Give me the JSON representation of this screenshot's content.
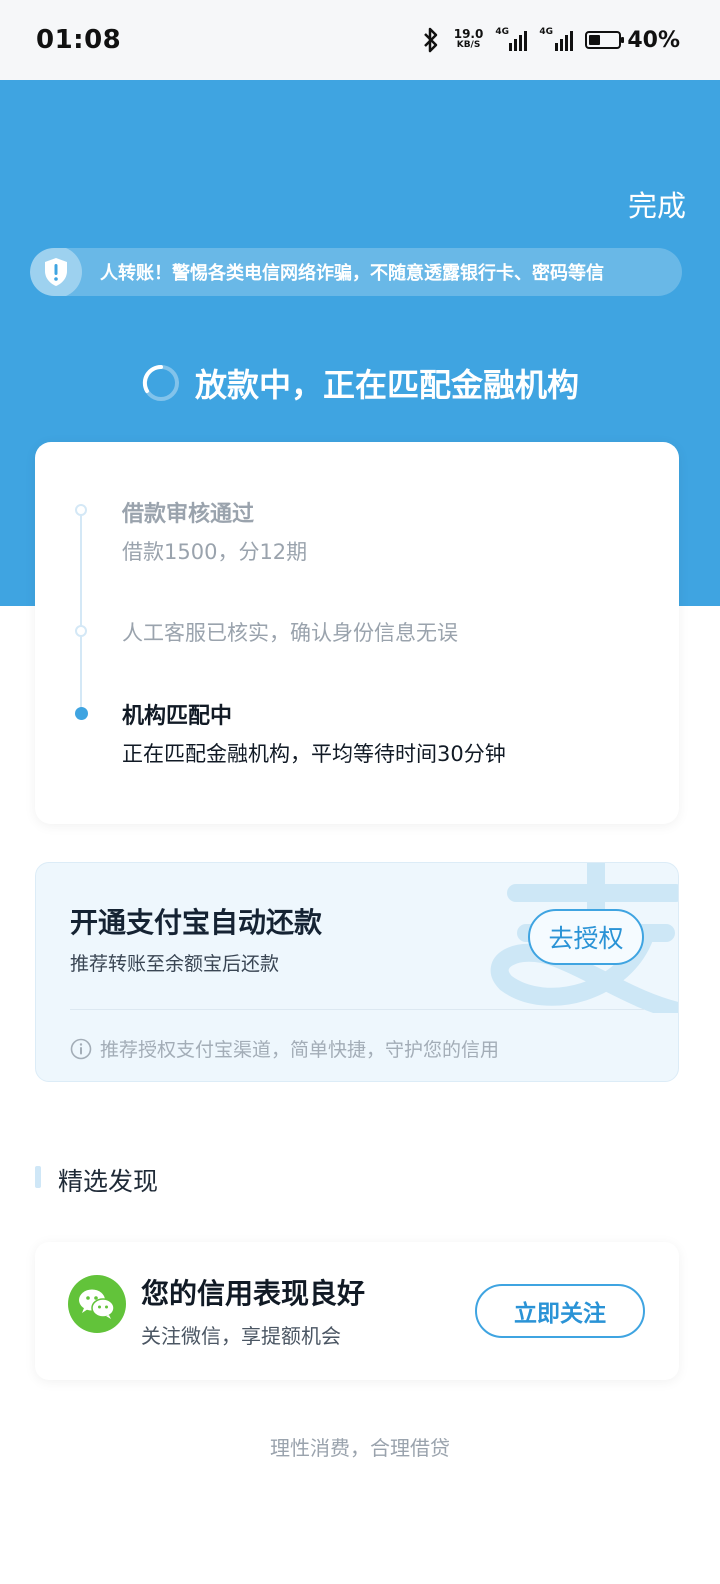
{
  "status_bar": {
    "time": "01:08",
    "net_speed": "19.0",
    "net_unit": "KB/S",
    "sim1_label": "4G",
    "sim2_label": "4G",
    "battery": "40%",
    "battery_level": 0.4
  },
  "header": {
    "done_label": "完成",
    "notice_text": "人转账！警惕各类电信网络诈骗，不随意透露银行卡、密码等信",
    "status_title": "放款中，正在匹配金融机构"
  },
  "progress": {
    "steps": [
      {
        "title": "借款审核通过",
        "desc": "借款1500，分12期"
      },
      {
        "title": "",
        "desc": "人工客服已核实，确认身份信息无误"
      },
      {
        "title": "机构匹配中",
        "desc": "正在匹配金融机构，平均等待时间30分钟"
      }
    ]
  },
  "alipay_card": {
    "title": "开通支付宝自动还款",
    "subtitle": "推荐转账至余额宝后还款",
    "button": "去授权",
    "tip": "推荐授权支付宝渠道，简单快捷，守护您的信用"
  },
  "discover": {
    "section_title": "精选发现",
    "card_title": "您的信用表现良好",
    "card_subtitle": "关注微信，享提额机会",
    "button": "立即关注"
  },
  "footer": {
    "slogan": "理性消费，合理借贷"
  },
  "colors": {
    "brand": "#3fa4e1",
    "wechat": "#62c33a"
  }
}
